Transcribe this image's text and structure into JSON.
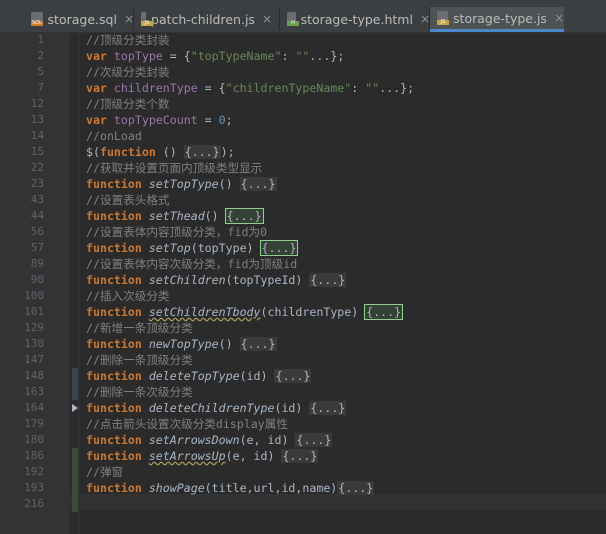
{
  "tabs": [
    {
      "label": "storage.sql",
      "icon": "sql-file-icon",
      "icon_color": "#c77b2b",
      "icon_sub": "SQL",
      "active": false
    },
    {
      "label": "patch-children.js",
      "icon": "js-file-icon",
      "icon_color": "#c7a64a",
      "icon_sub": "JS",
      "active": false
    },
    {
      "label": "storage-type.html",
      "icon": "html-file-icon",
      "icon_color": "#6e9e4f",
      "icon_sub": "H",
      "active": false
    },
    {
      "label": "storage-type.js",
      "icon": "js-file-icon",
      "icon_color": "#c7a64a",
      "icon_sub": "JS",
      "active": true
    }
  ],
  "close_glyph": "×",
  "lines": [
    {
      "num": "1",
      "tokens": [
        {
          "t": "//顶级分类封装",
          "c": "c"
        }
      ]
    },
    {
      "num": "2",
      "tokens": [
        {
          "t": "var ",
          "c": "k"
        },
        {
          "t": "topType",
          "c": "v"
        },
        {
          "t": " = {",
          "c": ""
        },
        {
          "t": "\"topTypeName\"",
          "c": "s"
        },
        {
          "t": ": ",
          "c": ""
        },
        {
          "t": "\"\"",
          "c": "s"
        },
        {
          "t": "...};",
          "c": ""
        }
      ]
    },
    {
      "num": "5",
      "tokens": [
        {
          "t": "//次级分类封装",
          "c": "c"
        }
      ]
    },
    {
      "num": "7",
      "tokens": [
        {
          "t": "var ",
          "c": "k"
        },
        {
          "t": "childrenType",
          "c": "v"
        },
        {
          "t": " = {",
          "c": ""
        },
        {
          "t": "\"childrenTypeName\"",
          "c": "s"
        },
        {
          "t": ": ",
          "c": ""
        },
        {
          "t": "\"\"",
          "c": "s"
        },
        {
          "t": "...};",
          "c": ""
        }
      ]
    },
    {
      "num": "12",
      "tokens": [
        {
          "t": "//顶级分类个数",
          "c": "c"
        }
      ]
    },
    {
      "num": "13",
      "tokens": [
        {
          "t": "var ",
          "c": "k"
        },
        {
          "t": "topTypeCount",
          "c": "v"
        },
        {
          "t": " = ",
          "c": ""
        },
        {
          "t": "0",
          "c": "n"
        },
        {
          "t": ";",
          "c": ""
        }
      ]
    },
    {
      "num": "14",
      "tokens": [
        {
          "t": "//onLoad",
          "c": "c"
        }
      ]
    },
    {
      "num": "15",
      "tokens": [
        {
          "t": "$(",
          "c": ""
        },
        {
          "t": "function",
          "c": "k"
        },
        {
          "t": " () ",
          "c": ""
        },
        {
          "t": "{...}",
          "c": "fold"
        },
        {
          "t": ");",
          "c": ""
        }
      ]
    },
    {
      "num": "22",
      "tokens": [
        {
          "t": "//获取并设置页面内顶级类型显示",
          "c": "c"
        }
      ]
    },
    {
      "num": "23",
      "tokens": [
        {
          "t": "function ",
          "c": "k"
        },
        {
          "t": "setTopType",
          "c": "fn"
        },
        {
          "t": "() ",
          "c": ""
        },
        {
          "t": "{...}",
          "c": "fold"
        }
      ]
    },
    {
      "num": "43",
      "tokens": [
        {
          "t": "//设置表头格式",
          "c": "c"
        }
      ]
    },
    {
      "num": "44",
      "tokens": [
        {
          "t": "function ",
          "c": "k"
        },
        {
          "t": "setThead",
          "c": "fn"
        },
        {
          "t": "() ",
          "c": ""
        },
        {
          "t": "{...}",
          "c": "fold hl"
        }
      ]
    },
    {
      "num": "56",
      "tokens": [
        {
          "t": "//设置表体内容顶级分类，fid为0",
          "c": "c"
        }
      ]
    },
    {
      "num": "57",
      "tokens": [
        {
          "t": "function ",
          "c": "k"
        },
        {
          "t": "setTop",
          "c": "fn"
        },
        {
          "t": "(topType) ",
          "c": ""
        },
        {
          "t": "{...}",
          "c": "fold hl"
        }
      ]
    },
    {
      "num": "89",
      "tokens": [
        {
          "t": "//设置表体内容次级分类，fid为顶级id",
          "c": "c"
        }
      ]
    },
    {
      "num": "90",
      "tokens": [
        {
          "t": "function ",
          "c": "k"
        },
        {
          "t": "setChildren",
          "c": "fn"
        },
        {
          "t": "(topTypeId) ",
          "c": ""
        },
        {
          "t": "{...}",
          "c": "fold"
        }
      ]
    },
    {
      "num": "100",
      "tokens": [
        {
          "t": "//插入次级分类",
          "c": "c"
        }
      ]
    },
    {
      "num": "101",
      "tokens": [
        {
          "t": "function ",
          "c": "k"
        },
        {
          "t": "setChildrenTbody",
          "c": "fn uw"
        },
        {
          "t": "(childrenType) ",
          "c": ""
        },
        {
          "t": "{...}",
          "c": "fold hl"
        }
      ]
    },
    {
      "num": "129",
      "tokens": [
        {
          "t": "//新增一条顶级分类",
          "c": "c"
        }
      ]
    },
    {
      "num": "130",
      "tokens": [
        {
          "t": "function ",
          "c": "k"
        },
        {
          "t": "newTopType",
          "c": "fn"
        },
        {
          "t": "() ",
          "c": ""
        },
        {
          "t": "{...}",
          "c": "fold"
        }
      ]
    },
    {
      "num": "147",
      "tokens": [
        {
          "t": "//删除一条顶级分类",
          "c": "c"
        }
      ]
    },
    {
      "num": "148",
      "tokens": [
        {
          "t": "function ",
          "c": "k"
        },
        {
          "t": "deleteTopType",
          "c": "fn"
        },
        {
          "t": "(id) ",
          "c": ""
        },
        {
          "t": "{...}",
          "c": "fold"
        }
      ]
    },
    {
      "num": "163",
      "tokens": [
        {
          "t": "//删除一条次级分类",
          "c": "c"
        }
      ]
    },
    {
      "num": "164",
      "tokens": [
        {
          "t": "function ",
          "c": "k"
        },
        {
          "t": "deleteChildrenType",
          "c": "fn"
        },
        {
          "t": "(id) ",
          "c": ""
        },
        {
          "t": "{...}",
          "c": "fold"
        }
      ]
    },
    {
      "num": "179",
      "tokens": [
        {
          "t": "//点击箭头设置次级分类display属性",
          "c": "c"
        }
      ]
    },
    {
      "num": "180",
      "tokens": [
        {
          "t": "function ",
          "c": "k"
        },
        {
          "t": "setArrowsDown",
          "c": "fn"
        },
        {
          "t": "(e, id) ",
          "c": ""
        },
        {
          "t": "{...}",
          "c": "fold"
        }
      ]
    },
    {
      "num": "186",
      "tokens": [
        {
          "t": "function ",
          "c": "k"
        },
        {
          "t": "setArrowsUp",
          "c": "fn uw"
        },
        {
          "t": "(e, id) ",
          "c": ""
        },
        {
          "t": "{...}",
          "c": "fold"
        }
      ]
    },
    {
      "num": "192",
      "tokens": [
        {
          "t": "//弹窗",
          "c": "c"
        }
      ]
    },
    {
      "num": "193",
      "tokens": [
        {
          "t": "function ",
          "c": "k"
        },
        {
          "t": "showPage",
          "c": "fn"
        },
        {
          "t": "(title,url,id,name)",
          "c": ""
        },
        {
          "t": "{...}",
          "c": "fold"
        }
      ]
    },
    {
      "num": "216",
      "tokens": []
    }
  ],
  "change_markers": {
    "modified_color": "#374752",
    "added_color": "#384c38"
  }
}
